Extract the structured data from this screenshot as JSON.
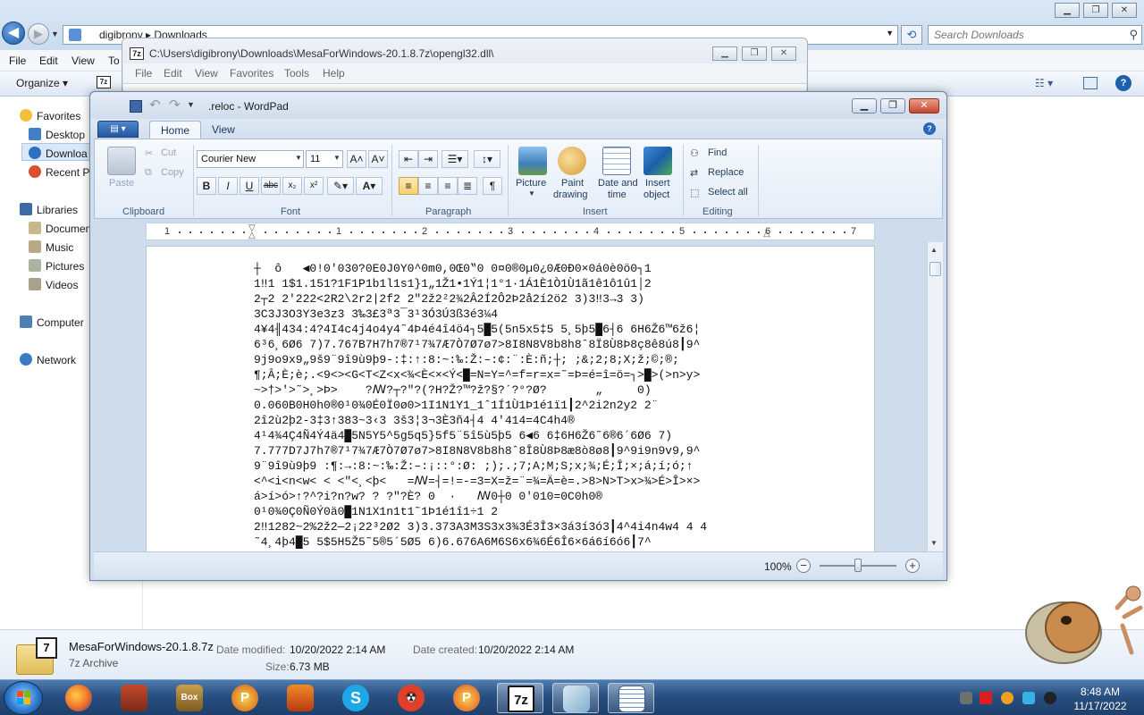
{
  "explorer": {
    "address": "digibrony  ▸  Downloads",
    "search_placeholder": "Search Downloads",
    "menu": [
      "File",
      "Edit",
      "View",
      "To"
    ],
    "organize_label": "Organize ▾",
    "nav": {
      "favorites": "Favorites",
      "desktop": "Desktop",
      "downloads": "Downloa",
      "recent": "Recent Pl",
      "libraries": "Libraries",
      "documents": "Documen",
      "music": "Music",
      "pictures": "Pictures",
      "videos": "Videos",
      "computer": "Computer",
      "network": "Network"
    },
    "details": {
      "name": "MesaForWindows-20.1.8.7z",
      "type": "7z Archive",
      "modified_label": "Date modified:",
      "modified_value": "10/20/2022 2:14 AM",
      "created_label": "Date created:",
      "created_value": "10/20/2022 2:14 AM",
      "size_label": "Size:",
      "size_value": "6.73 MB",
      "badge": "7"
    }
  },
  "dll_window": {
    "title": "C:\\Users\\digibrony\\Downloads\\MesaForWindows-20.1.8.7z\\opengl32.dll\\",
    "icon_label": "7z",
    "menu": [
      "File",
      "Edit",
      "View",
      "Favorites",
      "Tools",
      "Help"
    ]
  },
  "wordpad": {
    "title": ".reloc - WordPad",
    "tabs": {
      "home": "Home",
      "view": "View"
    },
    "clipboard": {
      "paste": "Paste",
      "cut": "Cut",
      "copy": "Copy",
      "group": "Clipboard"
    },
    "font": {
      "family": "Courier New",
      "size": "11",
      "group": "Font"
    },
    "paragraph": {
      "group": "Paragraph"
    },
    "insert": {
      "picture": "Picture",
      "paint1": "Paint",
      "paint2": "drawing",
      "date1": "Date and",
      "date2": "time",
      "object1": "Insert",
      "object2": "object",
      "group": "Insert"
    },
    "editing": {
      "find": "Find",
      "replace": "Replace",
      "select_all": "Select all",
      "group": "Editing"
    },
    "ruler_numbers": [
      "1",
      "1",
      "2",
      "3",
      "4",
      "5",
      "6",
      "7"
    ],
    "zoom": "100%",
    "zoom_fraction": 0.5,
    "content_lines": [
      "┼  ô   ◀0!0'030?0E0J0Y0^0m0,0Œ0‟0 0¤0®0µ0¿0Æ0Ð0×0á0è0ö0┐1",
      "1‼1 1$1.151?1F1P1b1l1s1}1„1Ž1•1Ý1¦1°1·1Á1È1Ò1Ù1ã1ê1ô1û1│2",
      "2┬2 2'222<2R2\\2r2|2f2 2″2ž2²2¾2Â2Í2Ô2Þ2å2í2ö2 3)3‼3→3 3)",
      "3C3J3O3Y3e3z3 3‰3£3ª3¯3¹3Ó3Ú3ß3é3¼4",
      "4¥4╢434:4?4I4c4j4o4y4˜4Þ4é4î4ö4┐5█5(5n5x5‡5 5¸5þ5█6┤6 6H6Ž6™6ž6¦",
      "6³6¸6Ø6 7)7.767B7H7h7®7¹7¾7Æ7Ò7Ø7ø7>8I8N8V8b8h8ˆ8Ï8Ù8Þ8ç8ê8ú8┃9^",
      "9j9o9x9„9š9¨9î9ù9þ9-:‡:↑:8:~:‰:Ž:–:¢:¨:È:ñ;┼; ;&;2;8;X;ž;©;®;",
      "¶;Â;È;è;.<9<><G<T<Z<x<¾<È<×<Ý<█=N=Y=^=f=r=x=˜=Þ=é=î=ö=┐>█>(>n>y>",
      "~>†>'>˜>¸>Þ>    ?ꟿ?┬?\"?(?H?Ž?™?ž?§?´?°?Ø?       „     0)",
      "0.060B0H0h0®0¹0¾0É0Ï0ø0>1I1N1Y1_1ˆ1Í1Ù1Þ1é1ï1┃2^2i2n2y2 2¨",
      "2î2ù2þ2-3‡3↑383~3‹3 3š3¦3¬3È3ñ4┤4 4'414=4C4h4®",
      "4¹4¾4Ç4Ñ4Ý4ä4█5N5Y5^5g5q5}5f5¨5î5ù5þ5 6◀6 6‡6H6Ž6˜6®6´6Ø6 7)",
      "7.777D7J7h7®7¹7¾7Æ7Ò7Ø7ø7>8I8N8V8b8h8ˆ8Î8Ù8Þ8æ8ò8ø8┃9^9i9n9v9,9^",
      "9¨9î9ù9þ9 :¶:→:8:~:‰:Ž:–:¡::°:Ø: ;);.;7;A;M;S;x;¾;É;Î;×;á;í;ó;↑",
      "<^<i<n<w< < <\"<¸<þ<   =ꟿ=┤=!=-=3=X=ž=¨=¾=Ä=è=.>8>N>T>x>¾>É>Î>×>",
      "á>í>ó>↑?^?i?n?w? ? ?\"?È? 0  ·   ꟿ0┼0 0'010=0C0h0®",
      "0¹0¾0Ç0Ñ0Ý0ä0█1N1X1n1t1˜1Þ1é1î1÷1 2",
      "2‼1282~2%2ž2—2¡22³2Ø2 3)3.373A3M3S3x3¾3É3Î3×3á3í3ó3┃4^4i4n4w4 4 4",
      "˜4¸4þ4█5 5$5H5Ž5˜5®5´5Ø5 6)6.676A6M6S6x6¾6É6Î6×6á6í6ó6┃7^"
    ]
  },
  "taskbar": {
    "time": "8:48 AM",
    "date": "11/17/2022",
    "pinned": [
      "firefox",
      "bubble-game",
      "mahjong-box",
      "pinball",
      "app-orange",
      "skype",
      "radiation-app",
      "peach-app",
      "7-zip",
      "explorer-files",
      "wordpad"
    ],
    "labels": {
      "box": "Box",
      "sevenzip": "7z"
    }
  },
  "colors": {
    "accent": "#2b69b8",
    "taskbar": "#284f80",
    "close": "#c6452a"
  }
}
